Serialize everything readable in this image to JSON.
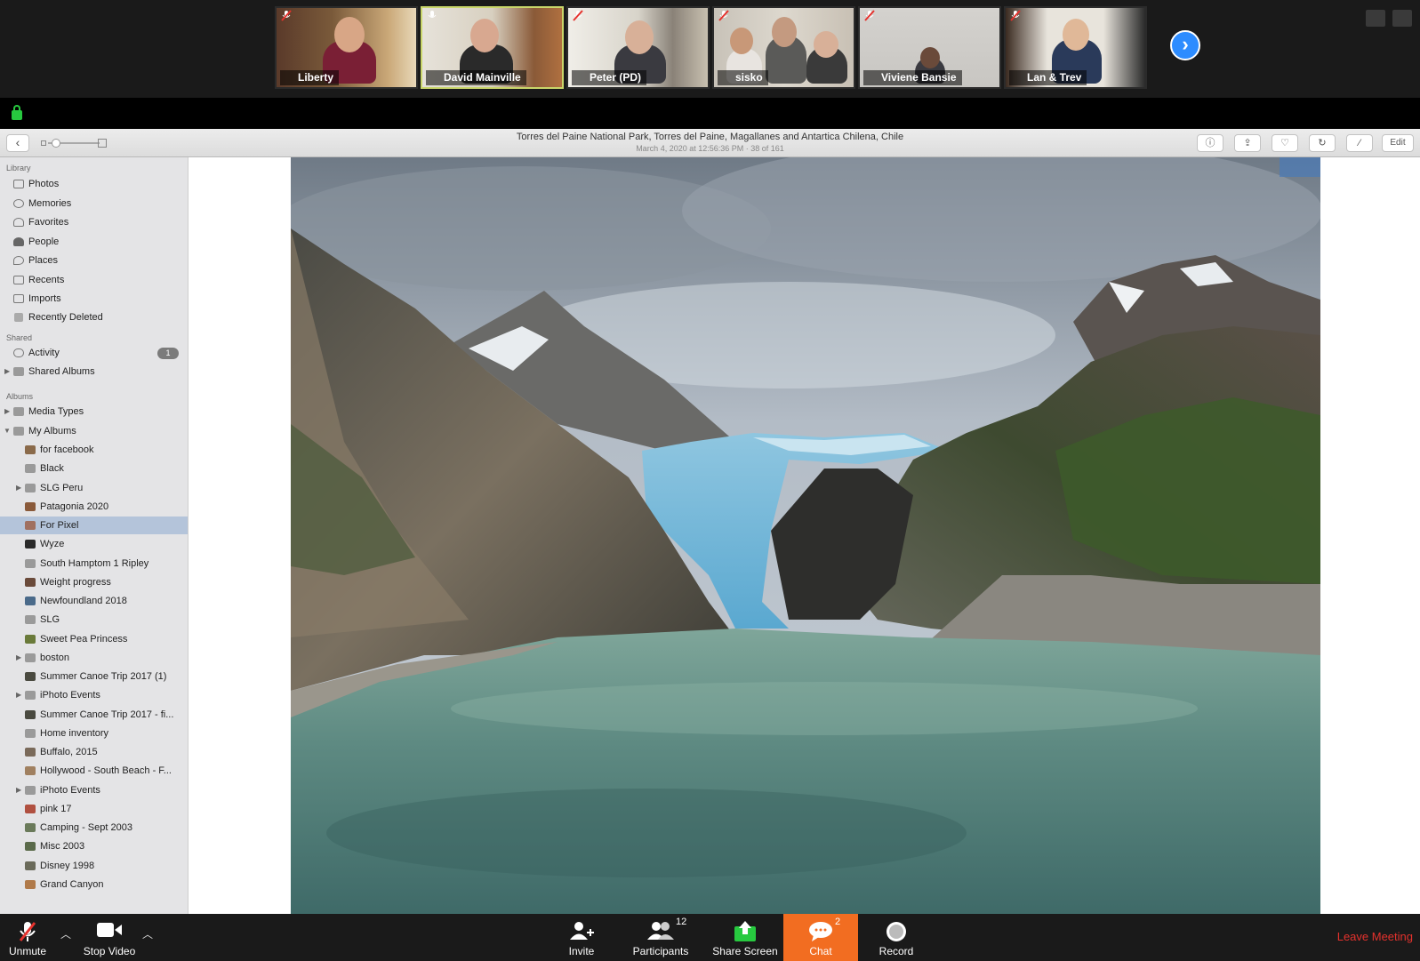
{
  "participants": [
    {
      "name": "Liberty"
    },
    {
      "name": "David Mainville"
    },
    {
      "name": "Peter (PD)"
    },
    {
      "name": "sisko"
    },
    {
      "name": "Viviene Bansie"
    },
    {
      "name": "Lan & Trev"
    }
  ],
  "photo_title": "Torres del Paine National Park, Torres del Paine, Magallanes and Antartica Chilena, Chile",
  "photo_subtitle": "March 4, 2020 at 12:56:36 PM   ·   38 of 161",
  "toolbar": {
    "edit_label": "Edit"
  },
  "sidebar": {
    "library_header": "Library",
    "library_items": [
      "Photos",
      "Memories",
      "Favorites",
      "People",
      "Places",
      "Recents",
      "Imports",
      "Recently Deleted"
    ],
    "shared_header": "Shared",
    "activity_label": "Activity",
    "activity_badge": "1",
    "shared_albums_label": "Shared Albums",
    "albums_header": "Albums",
    "media_types_label": "Media Types",
    "my_albums_label": "My Albums",
    "album_items": [
      "for facebook",
      "Black",
      "SLG Peru",
      "Patagonia 2020",
      "For Pixel",
      "Wyze",
      "South Hamptom 1 Ripley",
      "Weight progress",
      "Newfoundland 2018",
      "SLG",
      "Sweet Pea Princess",
      "boston",
      "Summer Canoe Trip 2017 (1)",
      "iPhoto Events",
      "Summer Canoe Trip 2017 - fi...",
      "Home inventory",
      "Buffalo, 2015",
      "Hollywood - South Beach - F...",
      "iPhoto Events",
      "pink 17",
      "Camping - Sept 2003",
      "Misc 2003",
      "Disney 1998",
      "Grand Canyon"
    ],
    "selected_album": "For Pixel"
  },
  "bottombar": {
    "unmute": "Unmute",
    "stop_video": "Stop Video",
    "invite": "Invite",
    "participants": "Participants",
    "participants_count": "12",
    "share_screen": "Share Screen",
    "chat": "Chat",
    "chat_count": "2",
    "record": "Record",
    "leave": "Leave Meeting"
  },
  "colors": {
    "zoom_blue": "#2d8cff",
    "chat_orange": "#f26d21",
    "leave_red": "#e5322d",
    "active_speaker": "#c9d66a",
    "sidebar_selected": "#b4c4da"
  }
}
